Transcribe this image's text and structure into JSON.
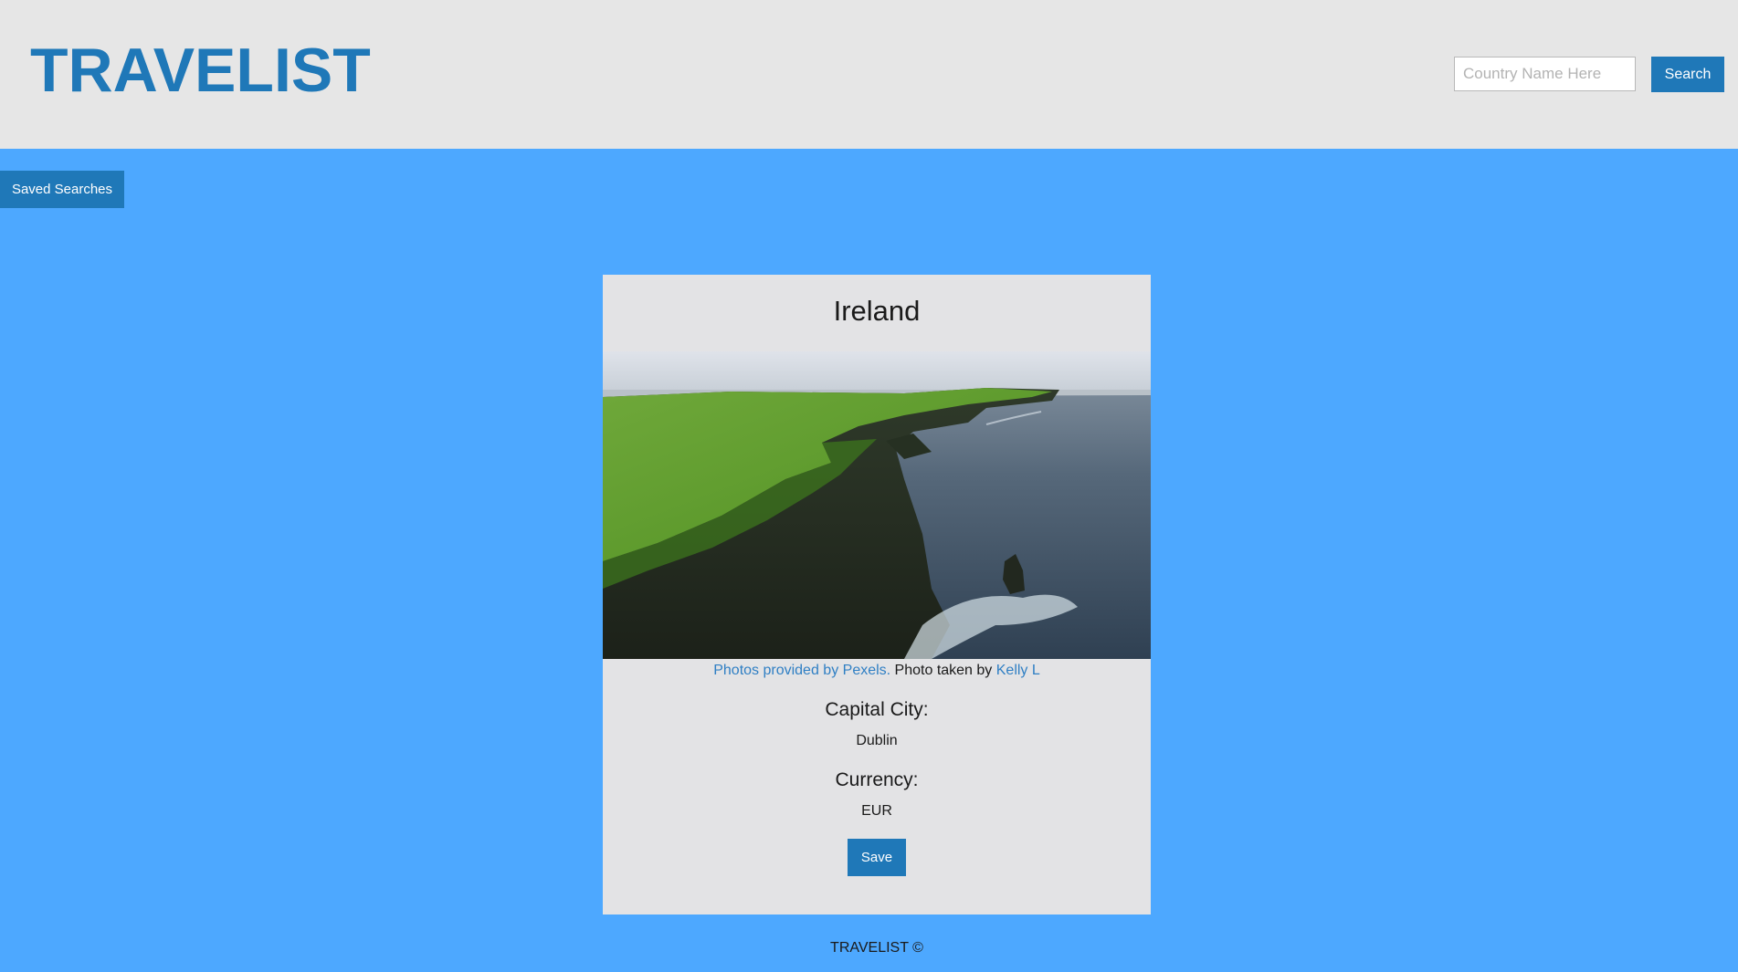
{
  "header": {
    "logo": "TRAVELIST",
    "search_placeholder": "Country Name Here",
    "search_value": "",
    "search_button": "Search"
  },
  "saved_searches_button": "Saved Searches",
  "card": {
    "country": "Ireland",
    "photo_alt": "Cliffs of Moher",
    "credit": {
      "provider_link": "Photos provided by Pexels.",
      "taken_by": " Photo taken by ",
      "photographer_link": "Kelly L"
    },
    "capital_label": "Capital City:",
    "capital_value": "Dublin",
    "currency_label": "Currency:",
    "currency_value": "EUR",
    "save_button": "Save"
  },
  "footer": "TRAVELIST ©",
  "colors": {
    "page_background": "#4da8ff",
    "header_background": "#e6e6e6",
    "accent": "#1f78b8",
    "card_background": "#e3e3e5",
    "link": "#2f7fc4"
  }
}
